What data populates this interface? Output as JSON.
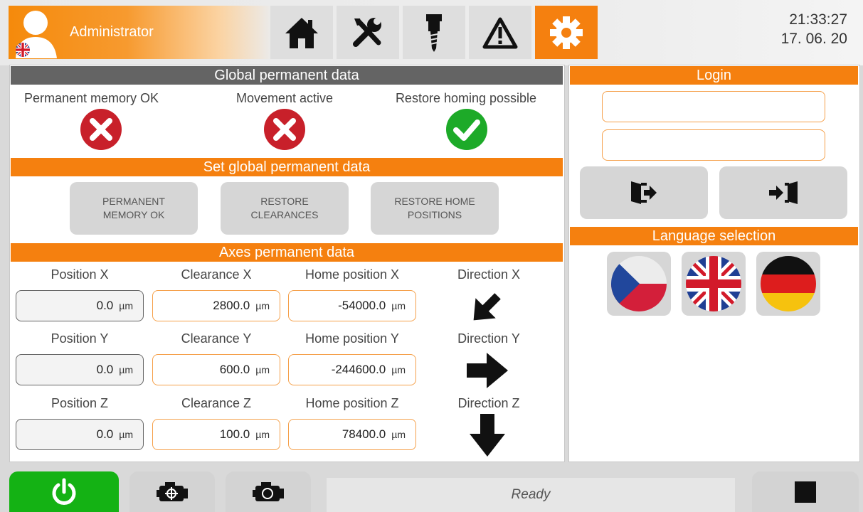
{
  "header": {
    "user_name": "Administrator",
    "time": "21:33:27",
    "date": "17. 06. 20",
    "nav": [
      {
        "icon": "home-icon"
      },
      {
        "icon": "tools-icon"
      },
      {
        "icon": "spindle-icon"
      },
      {
        "icon": "warning-icon"
      },
      {
        "icon": "gear-icon",
        "active": true
      }
    ],
    "accent_color": "#f5800f"
  },
  "global": {
    "title": "Global permanent data",
    "statuses": [
      {
        "label": "Permanent memory OK",
        "state": "error"
      },
      {
        "label": "Movement active",
        "state": "error"
      },
      {
        "label": "Restore homing possible",
        "state": "ok"
      }
    ]
  },
  "set_global": {
    "title": "Set global permanent data",
    "buttons": [
      {
        "line1": "PERMANENT",
        "line2": "MEMORY OK"
      },
      {
        "line1": "RESTORE",
        "line2": "CLEARANCES"
      },
      {
        "line1": "RESTORE HOME",
        "line2": "POSITIONS"
      }
    ]
  },
  "axes": {
    "title": "Axes permanent data",
    "unit": "µm",
    "rows": [
      {
        "pos_label": "Position X",
        "pos": "0.0",
        "clr_label": "Clearance X",
        "clr": "2800.0",
        "home_label": "Home position X",
        "home": "-54000.0",
        "dir_label": "Direction X",
        "dir": "down-left"
      },
      {
        "pos_label": "Position Y",
        "pos": "0.0",
        "clr_label": "Clearance Y",
        "clr": "600.0",
        "home_label": "Home position Y",
        "home": "-244600.0",
        "dir_label": "Direction Y",
        "dir": "right"
      },
      {
        "pos_label": "Position Z",
        "pos": "0.0",
        "clr_label": "Clearance Z",
        "clr": "100.0",
        "home_label": "Home position Z",
        "home": "78400.0",
        "dir_label": "Direction Z",
        "dir": "down"
      }
    ]
  },
  "login": {
    "title": "Login",
    "username_value": "",
    "password_value": "",
    "logout_icon": "logout-icon",
    "login_icon": "login-icon"
  },
  "language": {
    "title": "Language selection",
    "options": [
      "cs",
      "en",
      "de"
    ]
  },
  "footer": {
    "status": "Ready",
    "power_color": "#14b214"
  }
}
